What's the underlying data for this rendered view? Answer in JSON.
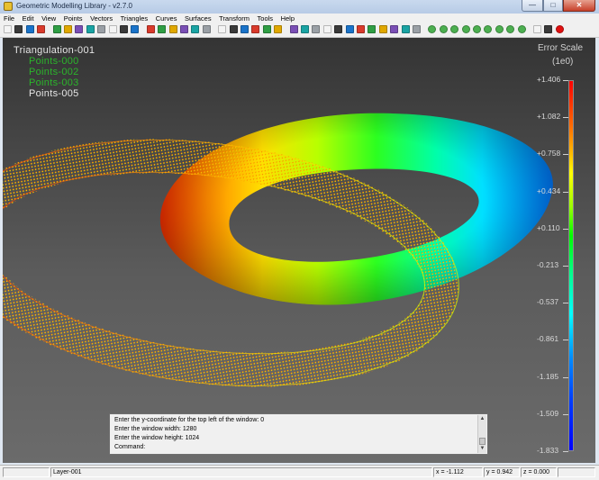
{
  "window": {
    "title": "Geometric Modelling Library - v2.7.0",
    "min_glyph": "—",
    "max_glyph": "□",
    "close_glyph": "✕"
  },
  "menu": [
    "File",
    "Edit",
    "View",
    "Points",
    "Vectors",
    "Triangles",
    "Curves",
    "Surfaces",
    "Transform",
    "Tools",
    "Help"
  ],
  "toolbar_icons": [
    "new-icon",
    "open-icon",
    "save-icon",
    "delete-icon",
    "copy-icon",
    "paste-icon",
    "move-icon",
    "scale-icon",
    "rotate-icon",
    "mirror-icon",
    "undo-icon",
    "redo-icon",
    "axis-x-icon",
    "axis-y-icon",
    "axis-z-icon",
    "axis-xy-icon",
    "axis-yz-icon",
    "axis-zx-icon",
    "layer-icon",
    "fit-icon",
    "render-icon",
    "points-icon",
    "vectors-icon",
    "light-icon",
    "grid-icon",
    "wire-icon",
    "solid-icon",
    "shade-icon",
    "texture-icon",
    "face-icon",
    "measure-icon",
    "curve-icon",
    "surface-icon",
    "mesh-icon",
    "sphere-icon",
    "torus-icon",
    "sphere2-icon",
    "sphere3-icon",
    "sphere4-icon",
    "sphere5-icon",
    "cut-icon",
    "sphere6-icon",
    "sphere7-icon",
    "sphere8-icon",
    "sphere9-icon",
    "pen-icon",
    "pause-icon",
    "record-icon"
  ],
  "layers": [
    {
      "name": "Triangulation-001",
      "color": "#e6e6e6"
    },
    {
      "name": "Points-000",
      "color": "#2bb52b"
    },
    {
      "name": "Points-002",
      "color": "#2bb52b"
    },
    {
      "name": "Points-003",
      "color": "#2bb52b"
    },
    {
      "name": "Points-005",
      "color": "#e6e6e6"
    }
  ],
  "error_scale": {
    "title": "Error Scale",
    "unit": "(1e0)",
    "ticks": [
      "+1.406",
      "+1.082",
      "+0.758",
      "+0.434",
      "+0.110",
      "-0.213",
      "-0.537",
      "-0.861",
      "-1.185",
      "-1.509",
      "-1.833"
    ]
  },
  "console": {
    "lines": [
      "Enter the y-coordinate for the top left of the window: 0",
      "Enter the window width: 1280",
      "Enter the window height: 1024",
      "Command:"
    ],
    "scroll_up": "▲",
    "scroll_down": "▼"
  },
  "status": {
    "layer": "Layer-001",
    "x": "x = -1.112",
    "y": "y = 0.942",
    "z": "z = 0.000"
  }
}
